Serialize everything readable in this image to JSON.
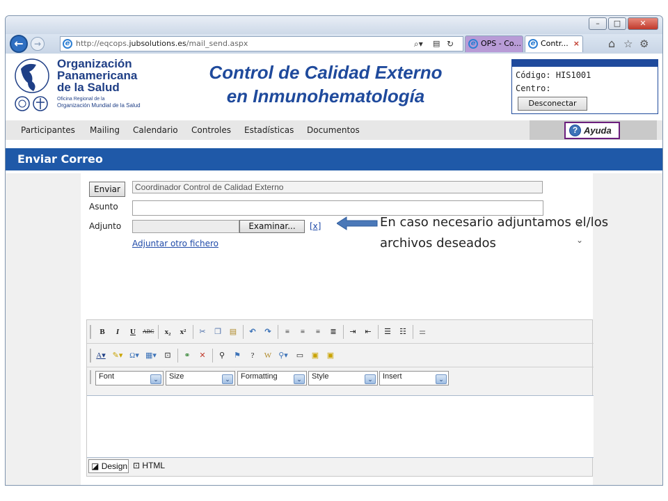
{
  "browser": {
    "address": {
      "prefix": "http://eqcops.",
      "domain": "jubsolutions.es",
      "path": "/mail_send.aspx"
    },
    "tabs": [
      {
        "label": "OPS - Co..."
      },
      {
        "label": "Contr...",
        "close": "×"
      }
    ],
    "icons": {
      "back": "back-icon",
      "forward": "forward-icon",
      "home": "home-icon",
      "favorites": "star-icon",
      "settings": "gear-icon"
    }
  },
  "header": {
    "org_name": [
      "Organización",
      "Panamericana",
      "de la Salud"
    ],
    "org_sub": [
      "Oficina Regional de la",
      "Organización Mundial de la Salud"
    ],
    "title_line1": "Control de Calidad Externo",
    "title_line2": "en Inmunohematología",
    "code_label": "Código:",
    "code_value": "HIS1001",
    "center_label": "Centro:",
    "logout_label": "Desconectar"
  },
  "menu": {
    "items": [
      "Participantes",
      "Mailing",
      "Calendario",
      "Controles",
      "Estadísticas",
      "Documentos"
    ],
    "help_label": "Ayuda"
  },
  "section_title": "Enviar Correo",
  "form": {
    "send_label": "Enviar",
    "to_value": "Coordinador Control de Calidad Externo",
    "subject_label": "Asunto",
    "subject_value": "",
    "attach_label": "Adjunto",
    "browse_label": "Examinar...",
    "remove_label": "[x]",
    "add_file_link": "Adjuntar otro fichero"
  },
  "editor": {
    "dropdowns": [
      "Font",
      "Size",
      "Formatting",
      "Style",
      "Insert"
    ],
    "design_tab": "Design",
    "html_tab": "HTML"
  },
  "annotation": {
    "text_line1": "En caso necesario adjuntamos el/los",
    "text_line2": "archivos deseados",
    "arrow_color": "#4a78b8"
  },
  "colors": {
    "brand_blue": "#1f59a8",
    "help_border": "#6b1f7d"
  }
}
